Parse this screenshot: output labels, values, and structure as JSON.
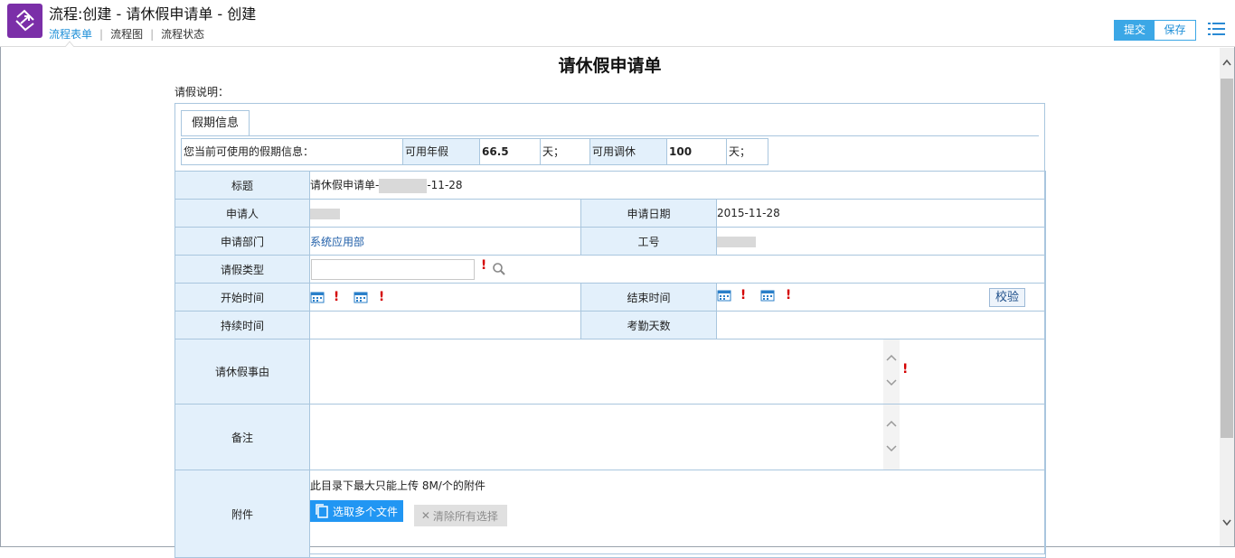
{
  "window": {
    "title": "流程:创建 - 请休假申请单 - 创建"
  },
  "nav": {
    "tabs": [
      "流程表单",
      "流程图",
      "流程状态"
    ]
  },
  "toolbar": {
    "submit_label": "提交",
    "save_label": "保存"
  },
  "form": {
    "title": "请休假申请单",
    "description_label": "请假说明：",
    "tab_label": "假期信息",
    "quota": {
      "label": "您当前可使用的假期信息：",
      "annual_label": "可用年假",
      "annual_value": "66.5",
      "annual_unit": "天；",
      "comp_label": "可用调休",
      "comp_value": "100",
      "comp_unit": "天；"
    },
    "fields": {
      "title_label": "标题",
      "title_prefix": "请休假申请单-",
      "title_suffix": "-11-28",
      "applicant_label": "申请人",
      "apply_date_label": "申请日期",
      "apply_date_value": "2015-11-28",
      "department_label": "申请部门",
      "department_value": "系统应用部",
      "employee_no_label": "工号",
      "leave_type_label": "请假类型",
      "start_time_label": "开始时间",
      "end_time_label": "结束时间",
      "check_button": "校验",
      "duration_label": "持续时间",
      "attendance_days_label": "考勤天数",
      "reason_label": "请休假事由",
      "remark_label": "备注",
      "attachment_label": "附件",
      "attachment_note": "此目录下最大只能上传 8M/个的附件",
      "pick_files_button": "选取多个文件",
      "clear_selection_button": "清除所有选择"
    }
  },
  "colors": {
    "accent": "#3ba7e6",
    "label_bg": "#e3f0fb",
    "border": "#a9c6de",
    "required": "#d40000",
    "logo": "#7b2fa8"
  }
}
